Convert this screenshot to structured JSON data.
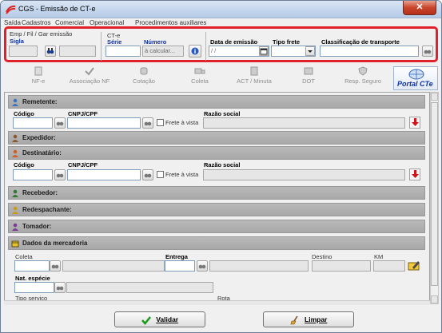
{
  "window": {
    "title": "CGS - Emissão de CT-e",
    "close_label": "✕",
    "menu": [
      "Saída",
      "Cadastros",
      "Comercial",
      "Operacional",
      "Procedimentos auxiliares"
    ]
  },
  "header": {
    "group_label": "Emp / Fil / Gar emissão",
    "sigla_label": "Sigla",
    "cte_group_label": "CT-e",
    "serie_label": "Série",
    "numero_label": "Número",
    "numero_value": "à calcular...",
    "data_emissao_label": "Data de emissão",
    "data_emissao_value": "/ /",
    "tipo_frete_label": "Tipo frete",
    "tipo_frete_value": "",
    "classificacao_label": "Classificação de transporte",
    "classificacao_value": ""
  },
  "toolbar": {
    "buttons": [
      "NF-e",
      "Associação NF",
      "Cotação",
      "Coleta",
      "ACT / Minuta",
      "DOT",
      "Resp. Seguro"
    ],
    "portal_label": "Portal CTe"
  },
  "remetente": {
    "title": "Remetente:",
    "codigo_label": "Código",
    "cnpj_label": "CNPJ/CPF",
    "frete_label": "Frete à vista",
    "razao_label": "Razão social"
  },
  "expedidor": {
    "title": "Expedidor:"
  },
  "destinatario": {
    "title": "Destinatário:",
    "codigo_label": "Código",
    "cnpj_label": "CNPJ/CPF",
    "frete_label": "Frete à vista",
    "razao_label": "Razão social"
  },
  "recebedor": {
    "title": "Recebedor:"
  },
  "redespachante": {
    "title": "Redespachante:"
  },
  "tomador": {
    "title": "Tomador:"
  },
  "mercadoria": {
    "title": "Dados da mercadoria",
    "coleta_label": "Coleta",
    "entrega_label": "Entrega",
    "destino_label": "Destino",
    "km_label": "KM",
    "nat_especie_label": "Nat. espécie",
    "tipo_servico_label": "Tipo serviço",
    "rota_label": "Rota"
  },
  "actions": {
    "validar_label": "Validar",
    "limpar_label": "Limpar"
  },
  "colors": {
    "highlight_border": "#e0202a",
    "section_bg": "#aaaaaa",
    "label_blue": "#1032a0"
  }
}
